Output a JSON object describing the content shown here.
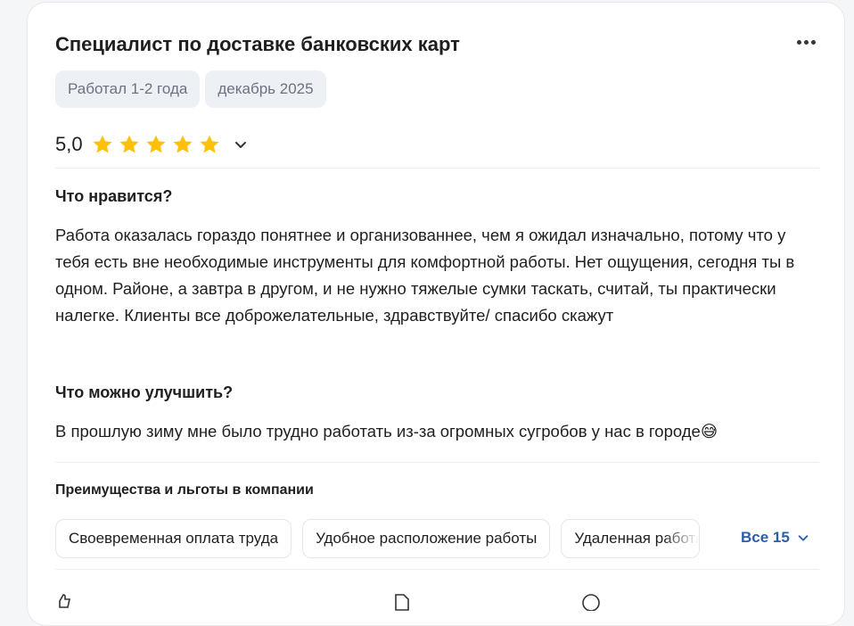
{
  "review": {
    "title": "Специалист по доставке банковских карт",
    "tags": [
      "Работал 1-2 года",
      "декабрь 2025"
    ],
    "rating": "5,0",
    "stars": 5,
    "likes_heading": "Что нравится?",
    "likes_text": "Работа оказалась гораздо понятнее и организованнее, чем я ожидал изначально, потому что у тебя есть вне необходимые инструменты для комфортной работы. Нет ощущения, сегодня ты в одном. Районе, а завтра в другом, и не нужно тяжелые сумки таскать, считай, ты практически налегке. Клиенты все доброжелательные, здравствуйте/ спасибо скажут",
    "improve_heading": "Что можно улучшить?",
    "improve_text": "В прошлую зиму мне было трудно работать из-за огромных сугробов у нас в городе😅",
    "benefits_title": "Преимущества и льготы в компании",
    "benefits": [
      "Своевременная оплата труда",
      "Удобное расположение работы",
      "Удаленная работа"
    ],
    "all_label": "Все 15"
  },
  "colors": {
    "star": "#ffc107",
    "link": "#2b5ea7",
    "tag_bg": "#edf0f4"
  }
}
